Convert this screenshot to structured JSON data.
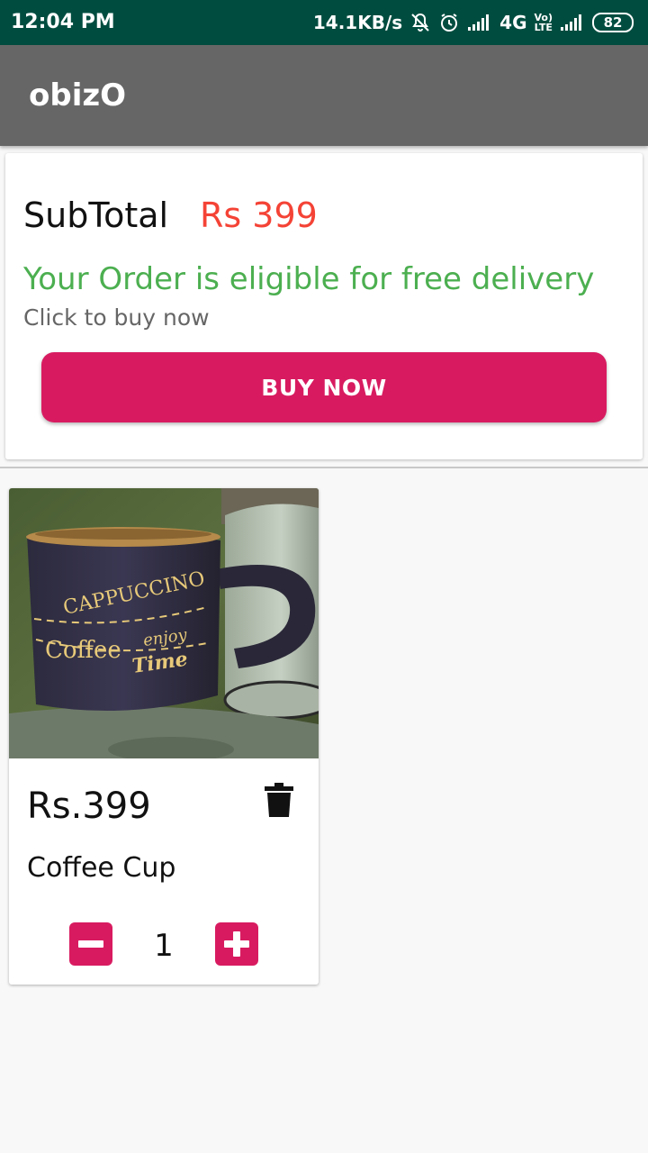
{
  "status_bar": {
    "time": "12:04 PM",
    "network_speed": "14.1KB/s",
    "network_type": "4G",
    "volte": "Vo)",
    "lte": "LTE",
    "battery": "82",
    "icons": [
      "mute-bell-icon",
      "alarm-icon",
      "signal-icon",
      "signal-icon"
    ]
  },
  "app_bar": {
    "title": "obizO"
  },
  "summary": {
    "subtotal_label": "SubTotal",
    "subtotal_value": "Rs 399",
    "eligible_message": "Your Order is eligible for free delivery",
    "hint": "Click to buy now",
    "buy_button_label": "BUY NOW"
  },
  "cart": {
    "items": [
      {
        "price": "Rs.399",
        "name": "Coffee Cup",
        "quantity": "1",
        "image_icon": "coffee-cup-photo"
      }
    ]
  },
  "colors": {
    "status_bar": "#004d40",
    "app_bar": "#666666",
    "accent": "#d81b60",
    "price_red": "#f44336",
    "success_green": "#4caf50"
  }
}
